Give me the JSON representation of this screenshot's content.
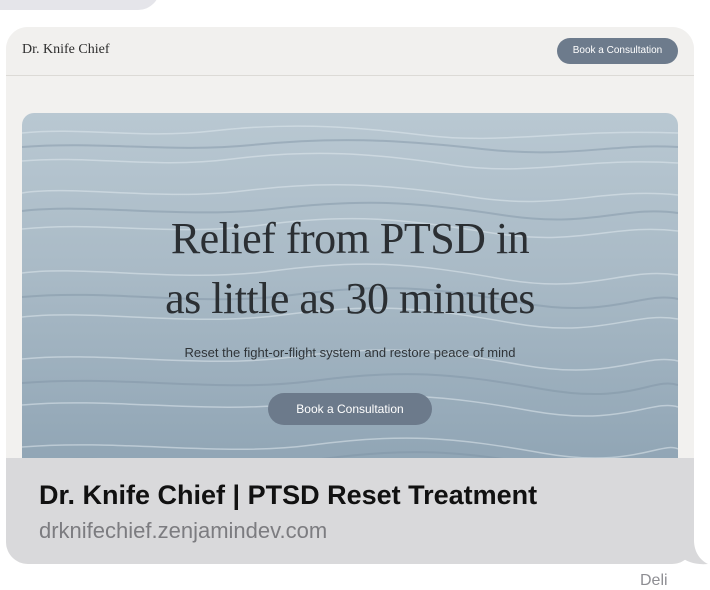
{
  "site": {
    "brand": "Dr. Knife Chief",
    "header_cta": "Book a Consultation"
  },
  "hero": {
    "title_line1": "Relief from PTSD in",
    "title_line2": "as little as 30 minutes",
    "subtitle": "Reset the fight-or-flight system and restore peace of mind",
    "cta": "Book a Consultation"
  },
  "link_preview": {
    "title": "Dr. Knife Chief | PTSD Reset Treatment",
    "domain": "drknifechief.zenjamindev.com"
  },
  "status": {
    "delivered": "Deli"
  },
  "colors": {
    "bubble": "#d9d9db",
    "button": "#6d7b8c",
    "water": "#a9b9c5"
  }
}
